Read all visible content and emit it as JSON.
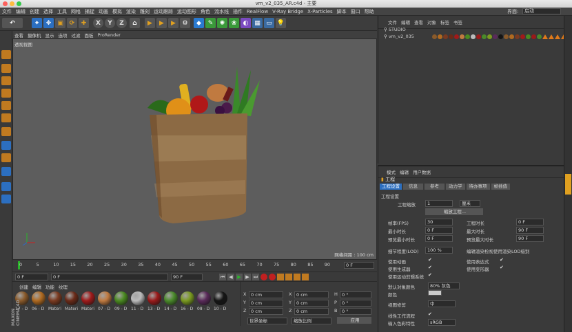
{
  "window": {
    "title": "vm_v2_035_AR.c4d - 主要"
  },
  "menu": {
    "items": [
      "文件",
      "编辑",
      "创建",
      "选择",
      "工具",
      "网格",
      "捕捉",
      "动画",
      "模拟",
      "渲染",
      "雕刻",
      "运动跟踪",
      "运动图形",
      "角色",
      "流水线",
      "插件",
      "RealFlow",
      "V-Ray Bridge",
      "X-Particles",
      "脚本",
      "窗口",
      "帮助"
    ],
    "layout_label": "界面:",
    "layout_value": "启动"
  },
  "toolbar": {
    "xyz": [
      "X",
      "Y",
      "Z"
    ]
  },
  "viewport": {
    "menu": [
      "查看",
      "摄像机",
      "显示",
      "选项",
      "过滤",
      "面板",
      "ProRender"
    ],
    "label": "透视视图",
    "grid_spacing": "网格间距 : 100 cm"
  },
  "timeline": {
    "ticks": [
      "0",
      "5",
      "10",
      "15",
      "20",
      "25",
      "30",
      "35",
      "40",
      "45",
      "50",
      "55",
      "60",
      "65",
      "70",
      "75",
      "80",
      "85",
      "90"
    ],
    "current_frame": "0 F"
  },
  "transport": {
    "start": "0 F",
    "current": "0 F",
    "end": "90 F",
    "end2": "90 F"
  },
  "materials": {
    "menu": [
      "创建",
      "编辑",
      "功能",
      "纹理"
    ],
    "items": [
      {
        "label": "17 - D",
        "color": "#8a5a2a"
      },
      {
        "label": "06 - D",
        "color": "#b06a20"
      },
      {
        "label": "Materi",
        "color": "#7a3a20"
      },
      {
        "label": "Materi",
        "color": "#6a2a18"
      },
      {
        "label": "Materi",
        "color": "#a01a1a"
      },
      {
        "label": "07 - D",
        "color": "#c07a40"
      },
      {
        "label": "09 - D",
        "color": "#4a8a20"
      },
      {
        "label": "11 - D",
        "color": "#bbbbbb"
      },
      {
        "label": "13 - D",
        "color": "#9a1a1a"
      },
      {
        "label": "14 - D",
        "color": "#4a8a2a"
      },
      {
        "label": "16 - D",
        "color": "#7a9a20"
      },
      {
        "label": "08 - D",
        "color": "#5a2a5a"
      },
      {
        "label": "10 - D",
        "color": "#151515"
      }
    ],
    "brand": "MAXON CINEMA 4D"
  },
  "coordinates": {
    "rows": [
      {
        "axis": "X",
        "pos": "0 cm",
        "axis2": "X",
        "size": "0 cm",
        "axis3": "H",
        "rot": "0 °"
      },
      {
        "axis": "Y",
        "pos": "0 cm",
        "axis2": "Y",
        "size": "0 cm",
        "axis3": "P",
        "rot": "0 °"
      },
      {
        "axis": "Z",
        "pos": "0 cm",
        "axis2": "Z",
        "size": "0 cm",
        "axis3": "B",
        "rot": "0 °"
      }
    ],
    "mode1": "世界坐标",
    "mode2": "缩放比例",
    "apply": "应用"
  },
  "objects": {
    "menu": [
      "文件",
      "编辑",
      "查看",
      "对象",
      "标签",
      "书签"
    ],
    "items": [
      {
        "name": "STUDIO"
      },
      {
        "name": "vm_v2_035"
      }
    ]
  },
  "attributes": {
    "menu": [
      "模式",
      "编辑",
      "用户数据"
    ],
    "object": "工程",
    "tabs": [
      "工程设置",
      "信息",
      "参考",
      "动力学",
      "待办事项",
      "帧插值"
    ],
    "section": "工程设置",
    "scale_label": "工程缩放",
    "scale_value": "1",
    "scale_unit": "厘米",
    "scale_button": "缩放工程...",
    "fps_label": "帧率(FPS)",
    "fps_value": "30",
    "project_len_label": "工程时长",
    "project_len_value": "0 F",
    "min_len_label": "最小时长",
    "min_len_value": "0 F",
    "max_len_label": "最大时长",
    "max_len_value": "90 F",
    "prev_min_label": "预览最小时长",
    "prev_min_value": "0 F",
    "prev_max_label": "预览最大时长",
    "prev_max_value": "90 F",
    "lod_label": "细节程度(LOD)",
    "lod_value": "100 %",
    "lod_render_label": "编辑渲染检视使用渲染LOD级别",
    "use_anim": "使用动画",
    "use_expr": "使用表达式",
    "use_gen": "使用生成器",
    "use_deform": "使用变形器",
    "use_motion": "使用运动剪辑系统",
    "default_color_label": "默认对象颜色",
    "default_color_value": "80% 灰色",
    "color_label": "颜色",
    "view_label": "视图修剪",
    "view_value": "中",
    "linear_label": "线性工作流程",
    "input_label": "输入色彩特性",
    "input_value": "sRGB"
  },
  "colors": {
    "accent_orange": "#e07a1a",
    "toolbar_blue": "#2c6fc0",
    "playhead": "#2ab52a"
  }
}
